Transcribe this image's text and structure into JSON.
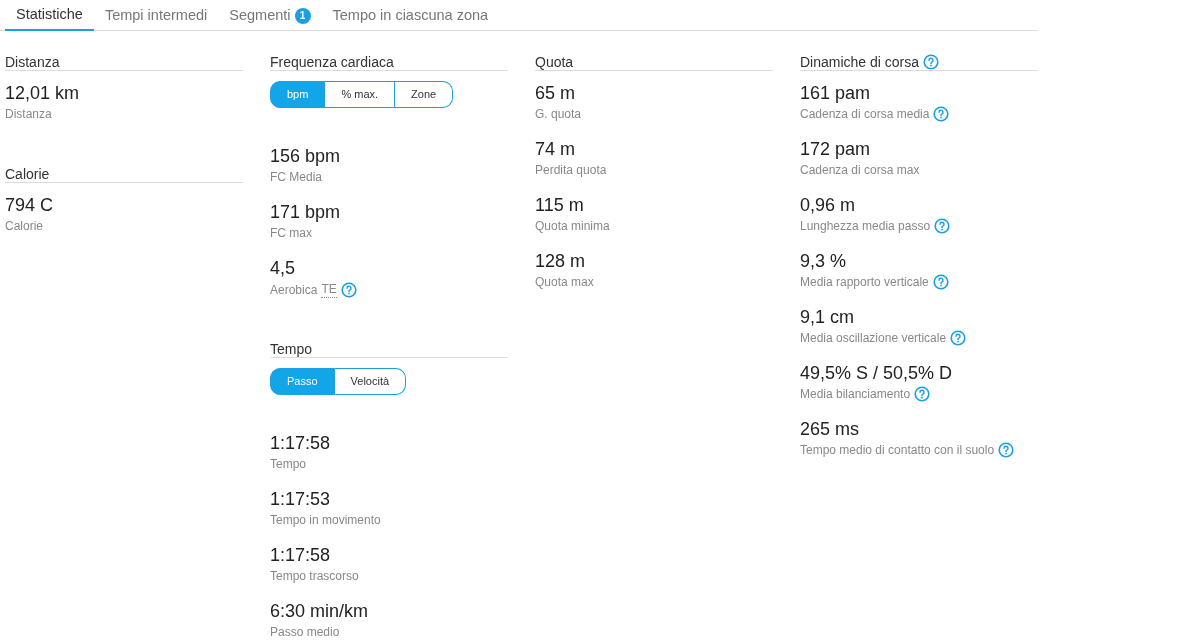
{
  "tabs": [
    {
      "label": "Statistiche",
      "selected": true
    },
    {
      "label": "Tempi intermedi",
      "selected": false
    },
    {
      "label": "Segmenti",
      "selected": false,
      "badge": "1"
    },
    {
      "label": "Tempo in ciascuna zona",
      "selected": false
    }
  ],
  "columns": [
    [
      {
        "title": "Distanza",
        "stats": [
          {
            "value": "12,01 km",
            "label": "Distanza"
          }
        ]
      },
      {
        "title": "Calorie",
        "stats": [
          {
            "value": "794 C",
            "label": "Calorie"
          }
        ]
      }
    ],
    [
      {
        "title": "Frequenza cardiaca",
        "toggle": [
          {
            "label": "bpm",
            "selected": true
          },
          {
            "label": "% max.",
            "selected": false
          },
          {
            "label": "Zone",
            "selected": false
          }
        ],
        "stats": [
          {
            "value": "156 bpm",
            "label": "FC Media"
          },
          {
            "value": "171 bpm",
            "label": "FC max"
          },
          {
            "value": "4,5",
            "label": "Aerobica",
            "abbr": "TE",
            "help": true
          }
        ]
      },
      {
        "title": "Tempo",
        "toggle": [
          {
            "label": "Passo",
            "selected": true
          },
          {
            "label": "Velocità",
            "selected": false
          }
        ],
        "stats": [
          {
            "value": "1:17:58",
            "label": "Tempo"
          },
          {
            "value": "1:17:53",
            "label": "Tempo in movimento"
          },
          {
            "value": "1:17:58",
            "label": "Tempo trascorso"
          },
          {
            "value": "6:30 min/km",
            "label": "Passo medio"
          }
        ]
      }
    ],
    [
      {
        "title": "Quota",
        "stats": [
          {
            "value": "65 m",
            "label": "G. quota"
          },
          {
            "value": "74 m",
            "label": "Perdita quota"
          },
          {
            "value": "115 m",
            "label": "Quota minima"
          },
          {
            "value": "128 m",
            "label": "Quota max"
          }
        ]
      }
    ],
    [
      {
        "title": "Dinamiche di corsa",
        "help": true,
        "stats": [
          {
            "value": "161 pam",
            "label": "Cadenza di corsa media",
            "help": true
          },
          {
            "value": "172 pam",
            "label": "Cadenza di corsa max"
          },
          {
            "value": "0,96 m",
            "label": "Lunghezza media passo",
            "help": true
          },
          {
            "value": "9,3 %",
            "label": "Media rapporto verticale",
            "help": true
          },
          {
            "value": "9,1 cm",
            "label": "Media oscillazione verticale",
            "help": true
          },
          {
            "value": "49,5% S / 50,5% D",
            "label": "Media bilanciamento",
            "help": true
          },
          {
            "value": "265 ms",
            "label": "Tempo medio di contatto con il suolo",
            "help": true
          }
        ]
      }
    ]
  ]
}
